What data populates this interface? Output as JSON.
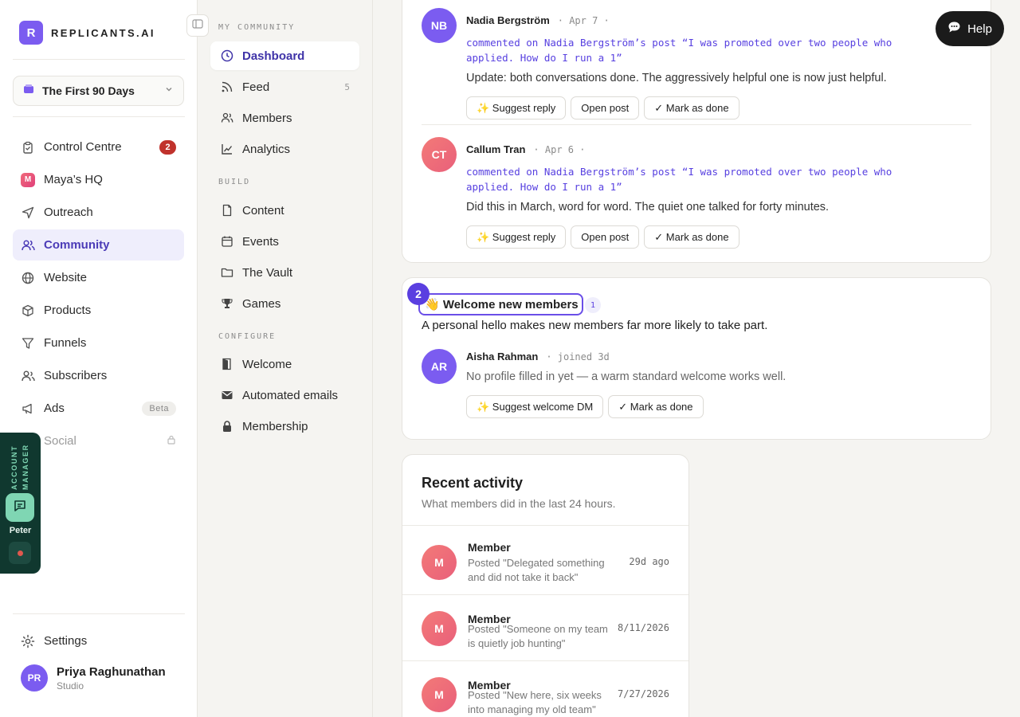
{
  "brand": {
    "logo_letter": "R",
    "name": "REPLICANTS.AI"
  },
  "workspace": {
    "label": "The First 90 Days"
  },
  "nav": [
    {
      "label": "Control Centre",
      "icon": "clipboard-icon",
      "badge": "2"
    },
    {
      "label": "Maya’s HQ",
      "icon": "maya-icon",
      "icon_letter": "M"
    },
    {
      "label": "Outreach",
      "icon": "send-icon"
    },
    {
      "label": "Community",
      "icon": "users-icon",
      "active": true
    },
    {
      "label": "Website",
      "icon": "globe-icon"
    },
    {
      "label": "Products",
      "icon": "box-icon"
    },
    {
      "label": "Funnels",
      "icon": "funnel-icon"
    },
    {
      "label": "Subscribers",
      "icon": "people-icon"
    },
    {
      "label": "Ads",
      "icon": "megaphone-icon",
      "badge": "Beta"
    },
    {
      "label": "Social",
      "icon": "share-icon",
      "locked": true
    }
  ],
  "settings_label": "Settings",
  "user": {
    "initials": "PR",
    "name": "Priya Raghunathan",
    "plan": "Studio"
  },
  "account_manager": {
    "title": "ACCOUNT MANAGER",
    "name": "Peter"
  },
  "subnav": {
    "sections": {
      "my_community": "MY COMMUNITY",
      "build": "BUILD",
      "configure": "CONFIGURE"
    },
    "items": {
      "dashboard": "Dashboard",
      "feed": "Feed",
      "feed_count": "5",
      "members": "Members",
      "analytics": "Analytics",
      "content": "Content",
      "events": "Events",
      "vault": "The Vault",
      "games": "Games",
      "welcome": "Welcome",
      "automated_emails": "Automated emails",
      "membership": "Membership"
    }
  },
  "comments": [
    {
      "initials": "NB",
      "name": "Nadia Bergström",
      "date": "· Apr 7 ·",
      "action": "commented on Nadia Bergström’s post “I was promoted over two people who applied. How do I run a 1”",
      "text": "Update: both conversations done. The aggressively helpful one is now just helpful.",
      "buttons": [
        "✨ Suggest reply",
        "Open post",
        "✓ Mark as done"
      ]
    },
    {
      "initials": "CT",
      "name": "Callum Tran",
      "date": "· Apr 6 ·",
      "action": "commented on Nadia Bergström’s post “I was promoted over two people who applied. How do I run a 1”",
      "text": "Did this in March, word for word. The quiet one talked for forty minutes.",
      "buttons": [
        "✨ Suggest reply",
        "Open post",
        "✓ Mark as done"
      ]
    }
  ],
  "welcome_card": {
    "step": "2",
    "title": "👋 Welcome new members",
    "count": "1",
    "subtitle": "A personal hello makes new members far more likely to take part.",
    "member": {
      "initials": "AR",
      "name": "Aisha Rahman",
      "meta": "· joined 3d",
      "note": "No profile filled in yet — a warm standard welcome works well.",
      "buttons": [
        "✨ Suggest welcome DM",
        "✓ Mark as done"
      ]
    }
  },
  "recent_activity": {
    "title": "Recent activity",
    "subtitle": "What members did in the last 24 hours.",
    "items": [
      {
        "initial": "M",
        "name": "Member",
        "desc": "Posted \"Delegated something and did not take it back\"",
        "time": "29d ago"
      },
      {
        "initial": "M",
        "name": "Member",
        "desc": "Posted \"Someone on my team is quietly job hunting\"",
        "time": "8/11/2026"
      },
      {
        "initial": "M",
        "name": "Member",
        "desc": "Posted \"New here, six weeks into managing my old team\"",
        "time": "7/27/2026"
      }
    ]
  },
  "help": {
    "label": "Help"
  },
  "colors": {
    "accent": "#5a3fe0",
    "brand": "#7b5cf0",
    "danger": "#c0322c",
    "am_panel": "#10382f"
  }
}
